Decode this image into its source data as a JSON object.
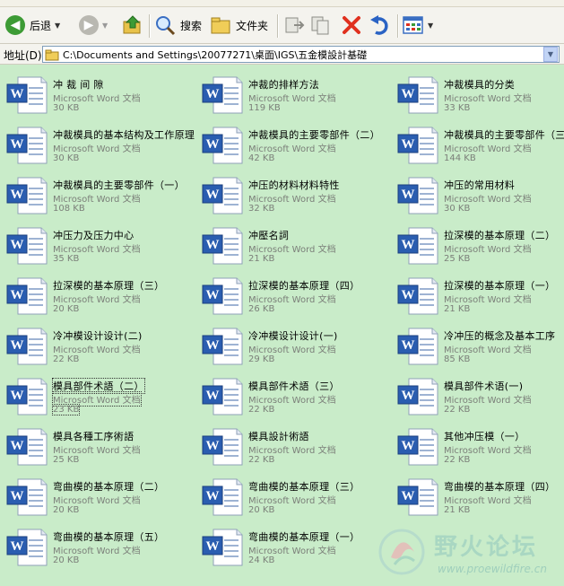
{
  "toolbar": {
    "back_label": "后退",
    "search_label": "搜索",
    "folders_label": "文件夹"
  },
  "address": {
    "label": "地址(D)",
    "path": "C:\\Documents and Settings\\20077271\\桌面\\IGS\\五金模設計基礎"
  },
  "files": [
    {
      "name": "冲 裁 间 隙",
      "type": "Microsoft Word 文档",
      "size": "30 KB"
    },
    {
      "name": "冲裁的排样方法",
      "type": "Microsoft Word 文档",
      "size": "119 KB"
    },
    {
      "name": "冲裁模具的分类",
      "type": "Microsoft Word 文档",
      "size": "33 KB"
    },
    {
      "name": "冲裁模具的基本结构及工作原理",
      "type": "Microsoft Word 文档",
      "size": "30 KB"
    },
    {
      "name": "冲裁模具的主要零部件（二）",
      "type": "Microsoft Word 文档",
      "size": "42 KB"
    },
    {
      "name": "冲裁模具的主要零部件（三）",
      "type": "Microsoft Word 文档",
      "size": "144 KB"
    },
    {
      "name": "冲裁模具的主要零部件（一）",
      "type": "Microsoft Word 文档",
      "size": "108 KB"
    },
    {
      "name": "冲压的材料材料特性",
      "type": "Microsoft Word 文档",
      "size": "32 KB"
    },
    {
      "name": "冲压的常用材料",
      "type": "Microsoft Word 文档",
      "size": "30 KB"
    },
    {
      "name": "冲压力及压力中心",
      "type": "Microsoft Word 文档",
      "size": "35 KB"
    },
    {
      "name": "冲壓名詞",
      "type": "Microsoft Word 文档",
      "size": "21 KB"
    },
    {
      "name": "拉深模的基本原理（二）",
      "type": "Microsoft Word 文档",
      "size": "25 KB"
    },
    {
      "name": "拉深模的基本原理（三）",
      "type": "Microsoft Word 文档",
      "size": "20 KB"
    },
    {
      "name": "拉深模的基本原理（四）",
      "type": "Microsoft Word 文档",
      "size": "26 KB"
    },
    {
      "name": "拉深模的基本原理（一）",
      "type": "Microsoft Word 文档",
      "size": "21 KB"
    },
    {
      "name": "冷冲模设计设计(二)",
      "type": "Microsoft Word 文档",
      "size": "22 KB"
    },
    {
      "name": "冷冲模设计设计(一)",
      "type": "Microsoft Word 文档",
      "size": "29 KB"
    },
    {
      "name": "冷冲压的概念及基本工序",
      "type": "Microsoft Word 文档",
      "size": "85 KB"
    },
    {
      "name": "模具部件术語（二）",
      "type": "Microsoft Word 文档",
      "size": "23 KB",
      "selected": true
    },
    {
      "name": "模具部件术語（三）",
      "type": "Microsoft Word 文档",
      "size": "22 KB"
    },
    {
      "name": "模具部件术语(一)",
      "type": "Microsoft Word 文档",
      "size": "22 KB"
    },
    {
      "name": "模具各種工序術語",
      "type": "Microsoft Word 文档",
      "size": "25 KB"
    },
    {
      "name": "模具設計術語",
      "type": "Microsoft Word 文档",
      "size": "22 KB"
    },
    {
      "name": "其他冲压模（一）",
      "type": "Microsoft Word 文档",
      "size": "22 KB"
    },
    {
      "name": "弯曲模的基本原理（二）",
      "type": "Microsoft Word 文档",
      "size": "20 KB"
    },
    {
      "name": "弯曲模的基本原理（三）",
      "type": "Microsoft Word 文档",
      "size": "20 KB"
    },
    {
      "name": "弯曲模的基本原理（四）",
      "type": "Microsoft Word 文档",
      "size": "21 KB"
    },
    {
      "name": "弯曲模的基本原理（五）",
      "type": "Microsoft Word 文档",
      "size": "20 KB"
    },
    {
      "name": "弯曲模的基本原理（一）",
      "type": "Microsoft Word 文档",
      "size": "24 KB"
    }
  ],
  "watermark": {
    "text": "野火论坛",
    "url": "www.proewildfire.cn"
  },
  "colors": {
    "view_background": "#c9ecc9",
    "toolbar_background": "#f4f3ee",
    "word_icon_blue": "#2a5db0",
    "delete_red": "#e0301e"
  }
}
